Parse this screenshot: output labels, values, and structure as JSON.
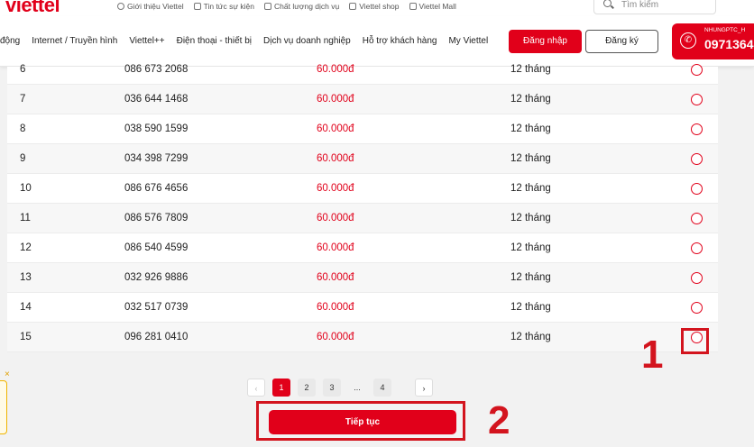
{
  "header": {
    "logo": "viettel",
    "top_links": [
      {
        "label": "Giới thiệu Viettel",
        "icon": "globe-icon"
      },
      {
        "label": "Tin tức sự kiện",
        "icon": "news-icon"
      },
      {
        "label": "Chất lượng dịch vụ",
        "icon": "quality-icon"
      },
      {
        "label": "Viettel shop",
        "icon": "shop-icon"
      },
      {
        "label": "Viettel Mall",
        "icon": "mall-icon"
      }
    ],
    "search_placeholder": "Tìm kiếm"
  },
  "nav": {
    "items": [
      "động",
      "Internet / Truyền hình",
      "Viettel++",
      "Điện thoại - thiết bị",
      "Dịch vụ doanh nghiệp",
      "Hỗ trợ khách hàng",
      "My Viettel"
    ],
    "login_label": "Đăng nhập",
    "register_label": "Đăng ký",
    "hotline_small": "NHUNGPTC_H",
    "hotline_number": "0971364"
  },
  "table": {
    "rows": [
      {
        "idx": "6",
        "number": "086 673 2068",
        "price": "60.000đ",
        "term": "12 tháng"
      },
      {
        "idx": "7",
        "number": "036 644 1468",
        "price": "60.000đ",
        "term": "12 tháng"
      },
      {
        "idx": "8",
        "number": "038 590 1599",
        "price": "60.000đ",
        "term": "12 tháng"
      },
      {
        "idx": "9",
        "number": "034 398 7299",
        "price": "60.000đ",
        "term": "12 tháng"
      },
      {
        "idx": "10",
        "number": "086 676 4656",
        "price": "60.000đ",
        "term": "12 tháng"
      },
      {
        "idx": "11",
        "number": "086 576 7809",
        "price": "60.000đ",
        "term": "12 tháng"
      },
      {
        "idx": "12",
        "number": "086 540 4599",
        "price": "60.000đ",
        "term": "12 tháng"
      },
      {
        "idx": "13",
        "number": "032 926 9886",
        "price": "60.000đ",
        "term": "12 tháng"
      },
      {
        "idx": "14",
        "number": "032 517 0739",
        "price": "60.000đ",
        "term": "12 tháng"
      },
      {
        "idx": "15",
        "number": "096 281 0410",
        "price": "60.000đ",
        "term": "12 tháng"
      }
    ]
  },
  "pagination": {
    "pages": [
      "1",
      "2",
      "3",
      "...",
      "4"
    ],
    "active": "1",
    "prev": "‹",
    "next": "›"
  },
  "continue_label": "Tiếp tục",
  "annotations": {
    "step1": "1",
    "step2": "2"
  },
  "side_close": "×",
  "colors": {
    "brand": "#e1001a",
    "annotation": "#d3141e"
  }
}
